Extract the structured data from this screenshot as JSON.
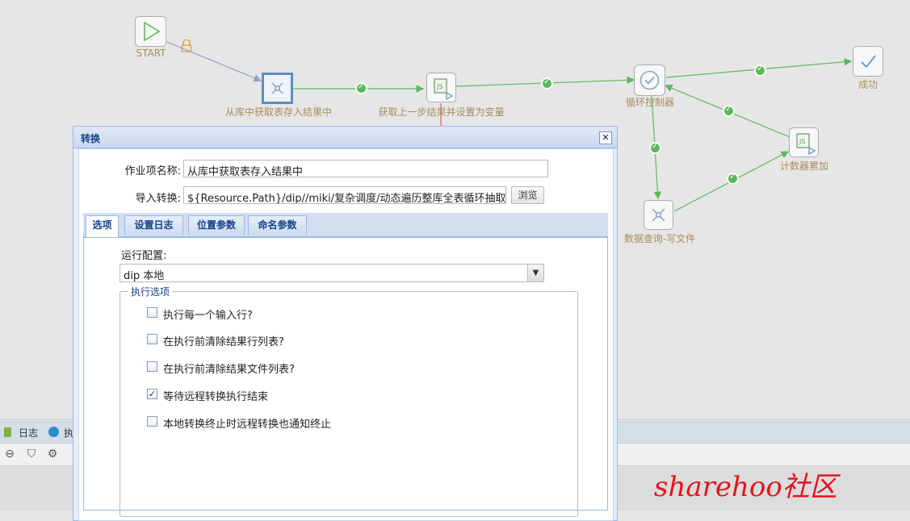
{
  "canvas": {
    "nodes": {
      "start": "START",
      "get_tables": "从库中获取表存入结果中",
      "set_vars": "获取上一步结果并设置为变量",
      "loop_controller": "循环控制器",
      "success": "成功",
      "counter": "计数器累加",
      "query_write": "数据查询-写文件"
    },
    "hop_color": "#5cb85c",
    "label_color": "#a88c5d"
  },
  "bottom_panel": {
    "tabs": [
      "日志",
      "执"
    ]
  },
  "dialog": {
    "title": "转换",
    "job_name_label": "作业项名称:",
    "job_name_value": "从库中获取表存入结果中",
    "import_label": "导入转换:",
    "import_value": "${Resource.Path}/dip//miki/复杂调度/动态遍历整库全表循环抽取",
    "browse_label": "浏览",
    "tabs": [
      "选项",
      "设置日志",
      "位置参数",
      "命名参数"
    ],
    "run_config_label": "运行配置:",
    "run_config_value": "dip 本地",
    "exec_options_legend": "执行选项",
    "checkboxes": [
      {
        "label": "执行每一个输入行?",
        "checked": false
      },
      {
        "label": "在执行前清除结果行列表?",
        "checked": false
      },
      {
        "label": "在执行前清除结果文件列表?",
        "checked": false
      },
      {
        "label": "等待远程转换执行结束",
        "checked": true
      },
      {
        "label": "本地转换终止时远程转换也通知终止",
        "checked": false
      }
    ]
  },
  "watermark": "sharehoo社区"
}
